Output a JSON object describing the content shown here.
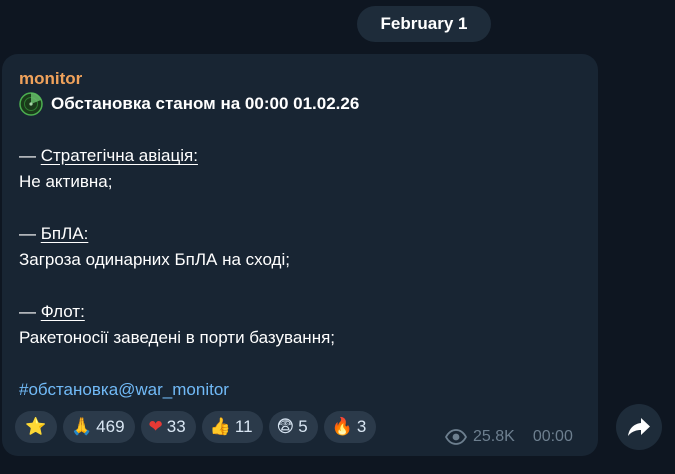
{
  "date_separator": "February 1",
  "message": {
    "author": "monitor",
    "headline": "Обстановка станом на 00:00 01.02.26",
    "sections": [
      {
        "dash": "— ",
        "title": "Стратегічна авіація:",
        "text": "Не активна;"
      },
      {
        "dash": "— ",
        "title": "БпЛА:",
        "text": "Загроза одинарних БпЛА на сході;"
      },
      {
        "dash": "— ",
        "title": "Флот:",
        "text": "Ракетоносії заведені в порти базування;"
      }
    ],
    "hashtag": "#обстановка@war_monitor",
    "views": "25.8K",
    "time": "00:00"
  },
  "reactions": [
    {
      "icon": "star-icon",
      "emoji": "⭐",
      "count": ""
    },
    {
      "icon": "praying-hands-icon",
      "emoji": "🙏",
      "count": "469"
    },
    {
      "icon": "heart-icon",
      "emoji": "❤",
      "count": "33"
    },
    {
      "icon": "thumbs-up-icon",
      "emoji": "👍",
      "count": "11"
    },
    {
      "icon": "anxious-face-icon",
      "emoji": "😨",
      "count": "5"
    },
    {
      "icon": "fire-icon",
      "emoji": "🔥",
      "count": "3"
    }
  ],
  "colors": {
    "background": "#0e1621",
    "bubble": "#182533",
    "author": "#f0a25b",
    "link": "#71baf7",
    "chip": "#2b3a4a",
    "meta": "#6d7f8f"
  }
}
